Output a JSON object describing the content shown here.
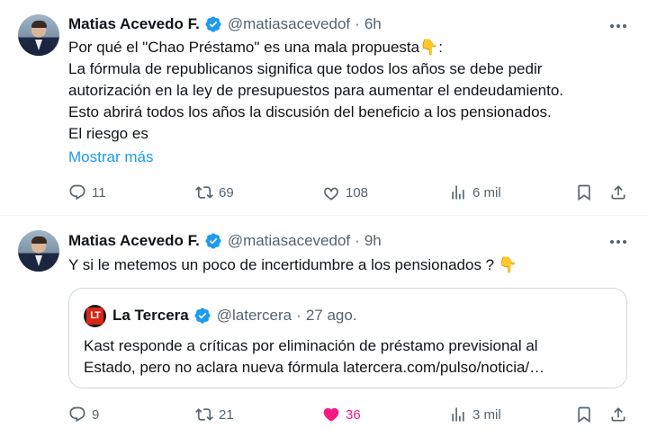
{
  "tweets": [
    {
      "author_name": "Matias Acevedo F.",
      "handle": "@matiasacevedof",
      "separator": "·",
      "time": "6h",
      "text_lines": [
        "Por qué el \"Chao Préstamo\" es una mala propuesta",
        "La fórmula de republicanos significa que todos los años se debe pedir",
        "autorización en la ley de presupuestos para aumentar el endeudamiento.",
        "Esto abrirá todos los años la discusión del beneficio a los pensionados.",
        "El riesgo es"
      ],
      "line1_suffix": ":",
      "emoji": "👇",
      "show_more": "Mostrar más",
      "replies": "11",
      "reposts": "69",
      "likes": "108",
      "views": "6 mil"
    },
    {
      "author_name": "Matias Acevedo F.",
      "handle": "@matiasacevedof",
      "separator": "·",
      "time": "9h",
      "text": "Y si le metemos un poco de incertidumbre a los pensionados ?",
      "emoji": "👇",
      "quote": {
        "logo_text": "LT",
        "author_name": "La Tercera",
        "handle": "@latercera",
        "separator": "·",
        "date": "27 ago.",
        "text_lines": [
          "Kast responde a críticas por eliminación de préstamo previsional al",
          "Estado, pero no aclara nueva fórmula latercera.com/pulso/noticia/…"
        ]
      },
      "replies": "9",
      "reposts": "21",
      "likes": "36",
      "liked": true,
      "views": "3 mil"
    }
  ],
  "colors": {
    "text": "#0f1419",
    "secondary": "#536471",
    "link": "#1d9bf0",
    "verified": "#1d9bf0",
    "like_active": "#f91880",
    "border": "#cfd9de"
  },
  "icons": {
    "more": "more-dots-icon",
    "reply": "reply-bubble-icon",
    "repost": "repost-arrows-icon",
    "like": "heart-icon",
    "views": "views-bar-chart-icon",
    "bookmark": "bookmark-icon",
    "share": "share-upload-icon",
    "verified": "verified-badge-icon"
  }
}
